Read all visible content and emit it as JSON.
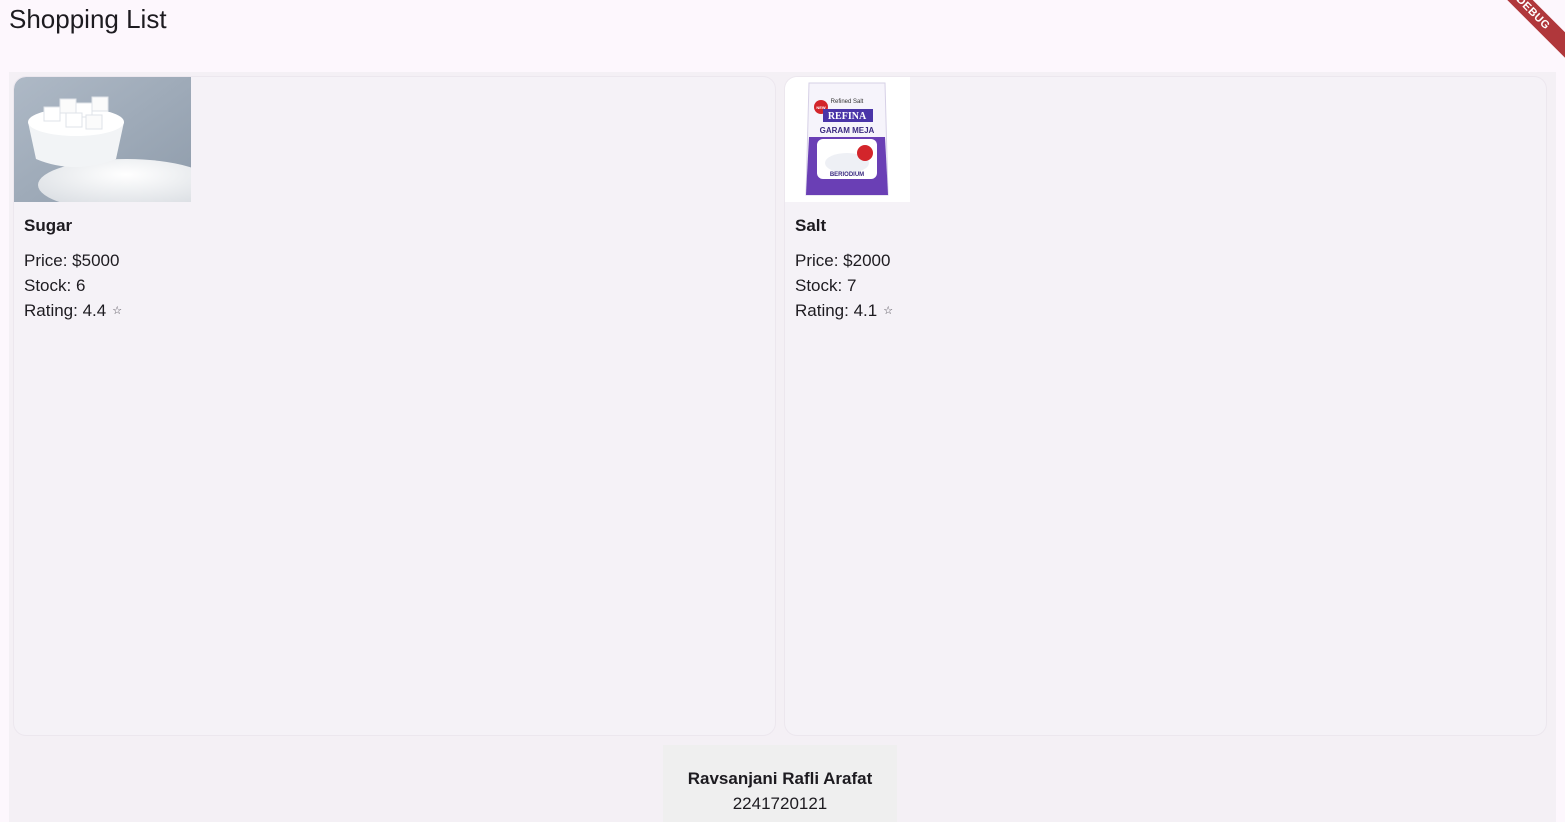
{
  "app": {
    "title": "Shopping List",
    "debug_label": "DEBUG"
  },
  "products": [
    {
      "name": "Sugar",
      "price_label": "Price: $5000",
      "stock_label": "Stock: 6",
      "rating_label": "Rating: 4.4",
      "rating_icon": "star-icon",
      "image": "sugar-bowl-image"
    },
    {
      "name": "Salt",
      "price_label": "Price: $2000",
      "stock_label": "Stock: 7",
      "rating_label": "Rating: 4.1",
      "rating_icon": "star-icon",
      "image": "salt-package-image",
      "package_text": {
        "top": "Refined Salt",
        "brand": "REFINA",
        "product": "GARAM MEJA",
        "bottom": "BERIODIUM",
        "badge": "NEW"
      }
    }
  ],
  "footer": {
    "name": "Ravsanjani Rafli Arafat",
    "id": "2241720121"
  },
  "colors": {
    "background": "#fdf7fd",
    "card": "#f5f2f7",
    "footer": "#efefef",
    "debug_banner": "#b0373b",
    "salt_package": "#6a3fb5"
  }
}
